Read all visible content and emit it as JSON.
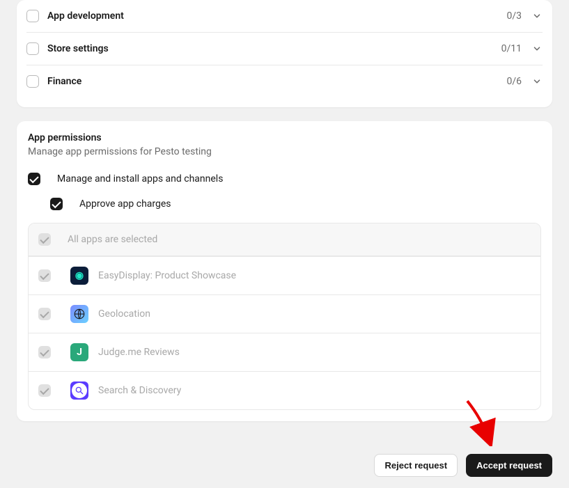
{
  "accordion": [
    {
      "label": "App development",
      "count": "0/3"
    },
    {
      "label": "Store settings",
      "count": "0/11"
    },
    {
      "label": "Finance",
      "count": "0/6"
    }
  ],
  "permissions": {
    "title": "App permissions",
    "subtitle": "Manage app permissions for Pesto testing",
    "manage_label": "Manage and install apps and channels",
    "approve_label": "Approve app charges",
    "all_apps_label": "All apps are selected"
  },
  "apps": [
    {
      "name": "EasyDisplay: Product Showcase"
    },
    {
      "name": "Geolocation"
    },
    {
      "name": "Judge.me Reviews"
    },
    {
      "name": "Search & Discovery"
    }
  ],
  "buttons": {
    "reject": "Reject request",
    "accept": "Accept request"
  }
}
